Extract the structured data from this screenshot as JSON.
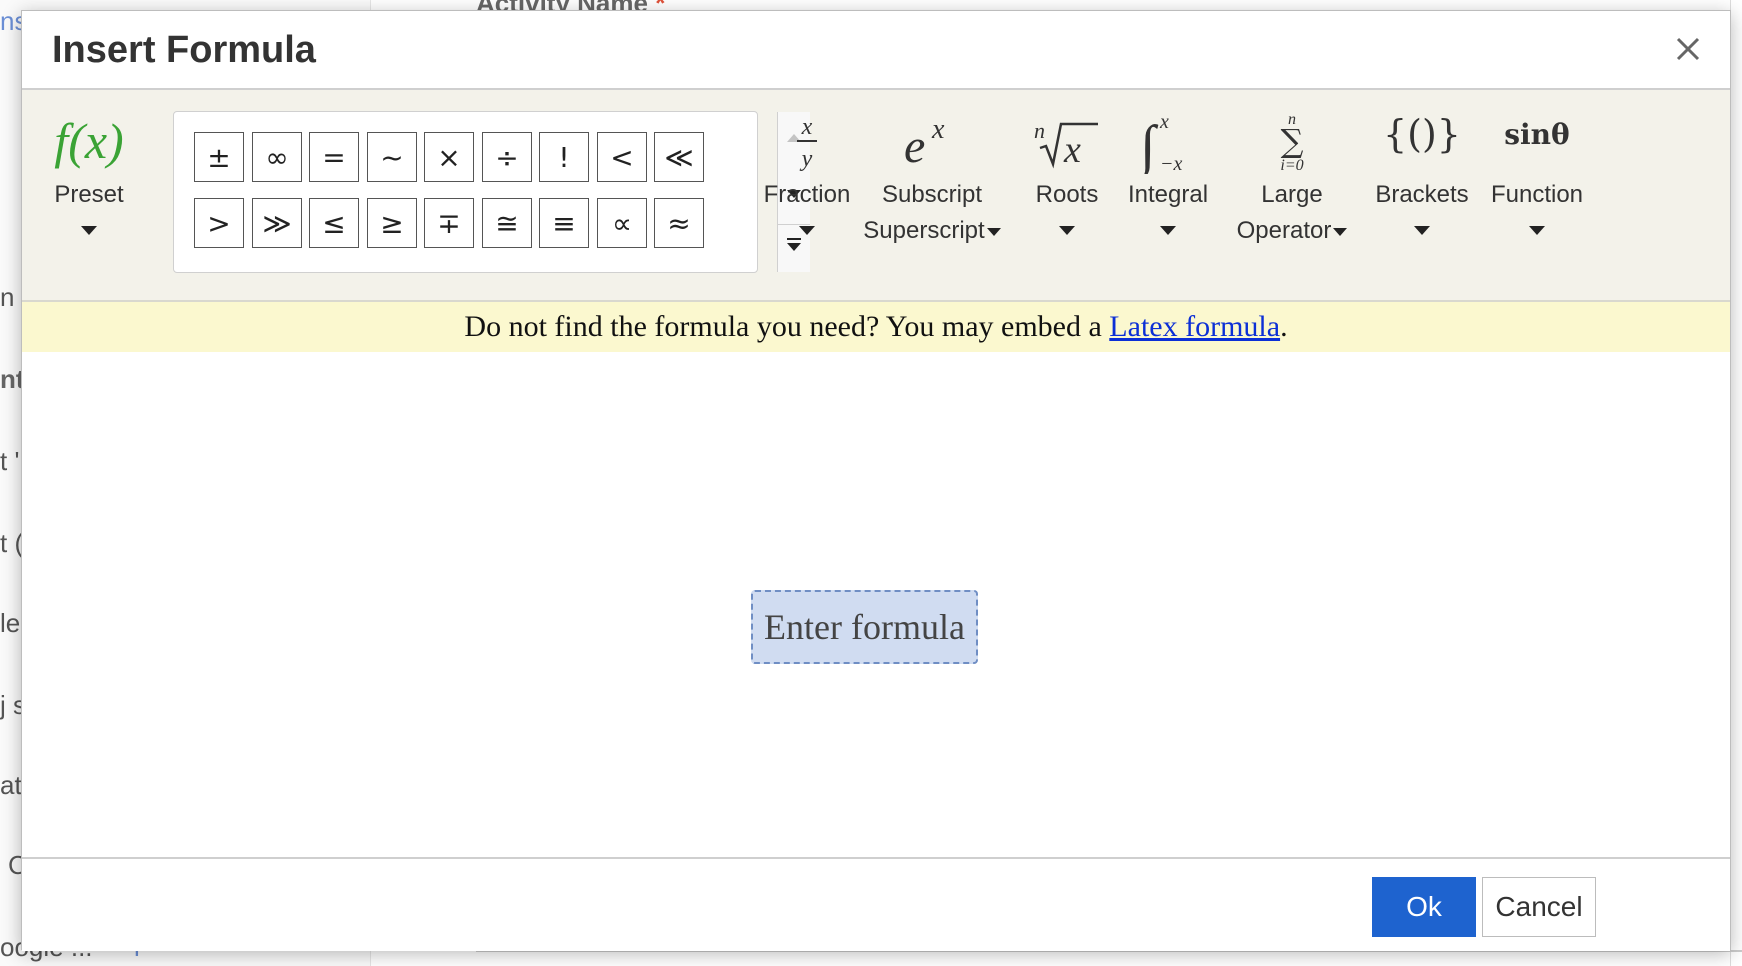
{
  "background": {
    "field_title": "Activity Name",
    "required_mark": "*",
    "fragments_left": [
      "ns",
      "n",
      "nt",
      "t '",
      "t (",
      "le",
      "j s",
      "at",
      "C",
      "oogle ...",
      "l"
    ]
  },
  "dialog": {
    "title": "Insert Formula",
    "close_icon": "close-icon"
  },
  "toolbar": {
    "preset": {
      "label": "Preset",
      "icon_text": "f(x)",
      "icon": "function-preset-icon"
    },
    "symbols": {
      "row1": [
        "±",
        "∞",
        "=",
        "~",
        "×",
        "÷",
        "!",
        "<",
        "≪"
      ],
      "row2": [
        ">",
        "≫",
        "≤",
        "≥",
        "∓",
        "≅",
        "≡",
        "∝",
        "≈"
      ]
    },
    "tools": [
      {
        "key": "fraction",
        "label": "Fraction",
        "label2": "",
        "icon": "fraction-icon"
      },
      {
        "key": "subscript",
        "label": "Subscript",
        "label2": "Superscript",
        "icon": "superscript-icon"
      },
      {
        "key": "roots",
        "label": "Roots",
        "label2": "",
        "icon": "root-icon"
      },
      {
        "key": "integral",
        "label": "Integral",
        "label2": "",
        "icon": "integral-icon"
      },
      {
        "key": "large",
        "label": "Large",
        "label2": "Operator",
        "icon": "sum-operator-icon"
      },
      {
        "key": "brackets",
        "label": "Brackets",
        "label2": "",
        "icon": "brackets-icon"
      },
      {
        "key": "function",
        "label": "Function",
        "label2": "",
        "icon": "function-icon"
      }
    ],
    "fraction": {
      "label": "Fraction"
    },
    "subscript": {
      "label": "Subscript",
      "label2": "Superscript"
    },
    "roots": {
      "label": "Roots"
    },
    "integral": {
      "label": "Integral"
    },
    "large": {
      "label": "Large",
      "label2": "Operator"
    },
    "brackets": {
      "label": "Brackets"
    },
    "function": {
      "label": "Function",
      "icon_text": "sinθ"
    }
  },
  "hint": {
    "prefix": "Do not find the formula you need? You may embed a ",
    "link": "Latex formula",
    "suffix": "."
  },
  "editor": {
    "placeholder": "Enter formula"
  },
  "footer": {
    "ok": "Ok",
    "cancel": "Cancel"
  },
  "colors": {
    "accent": "#1e63cf",
    "toolbar_bg": "#f3f2ea",
    "hint_bg": "#fbf8cf",
    "formula_box_bg": "#d0dcf1",
    "preset_green": "#3aa335",
    "link": "#0c2fd6"
  }
}
